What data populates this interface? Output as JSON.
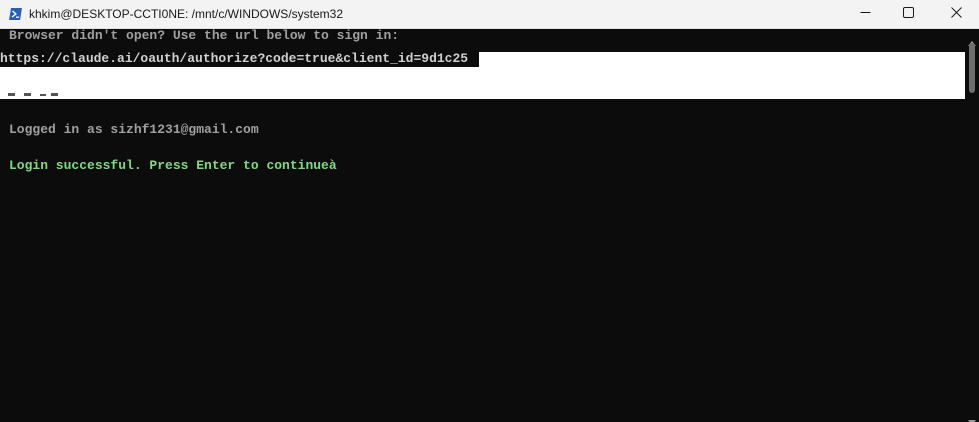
{
  "window": {
    "title": "khkim@DESKTOP-CCTI0NE: /mnt/c/WINDOWS/system32",
    "icon": "powershell-icon",
    "controls": {
      "minimize": "minimize-icon",
      "maximize": "maximize-icon",
      "close": "close-icon"
    }
  },
  "terminal": {
    "lines": {
      "browser_prompt": "Browser didn't open? Use the url below to sign in:",
      "auth_url": "https://claude.ai/oauth/authorize?code=true&client_id=9d1c25",
      "logged_in": "Logged in as sizhf1231@gmail.com",
      "login_success": "Login successful. Press Enter to continueà"
    },
    "colors": {
      "background": "#0c0c0c",
      "text": "#a0a0a0",
      "success": "#82d882",
      "highlight": "#ffffff"
    }
  }
}
